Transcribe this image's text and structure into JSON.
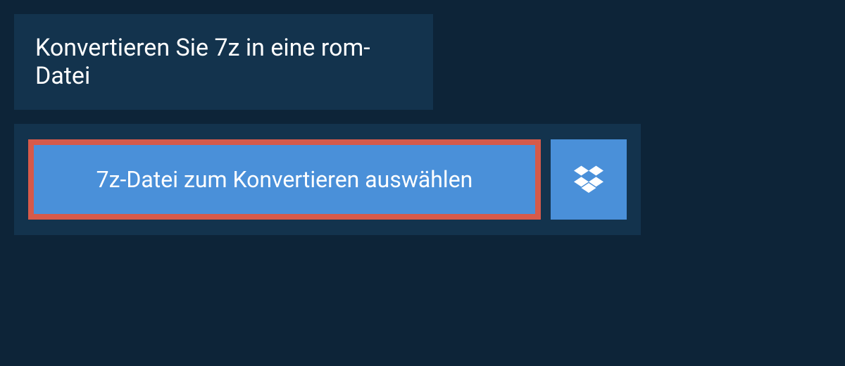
{
  "header": {
    "title": "Konvertieren Sie 7z in eine rom-Datei"
  },
  "upload": {
    "select_file_label": "7z-Datei zum Konvertieren auswählen"
  }
}
